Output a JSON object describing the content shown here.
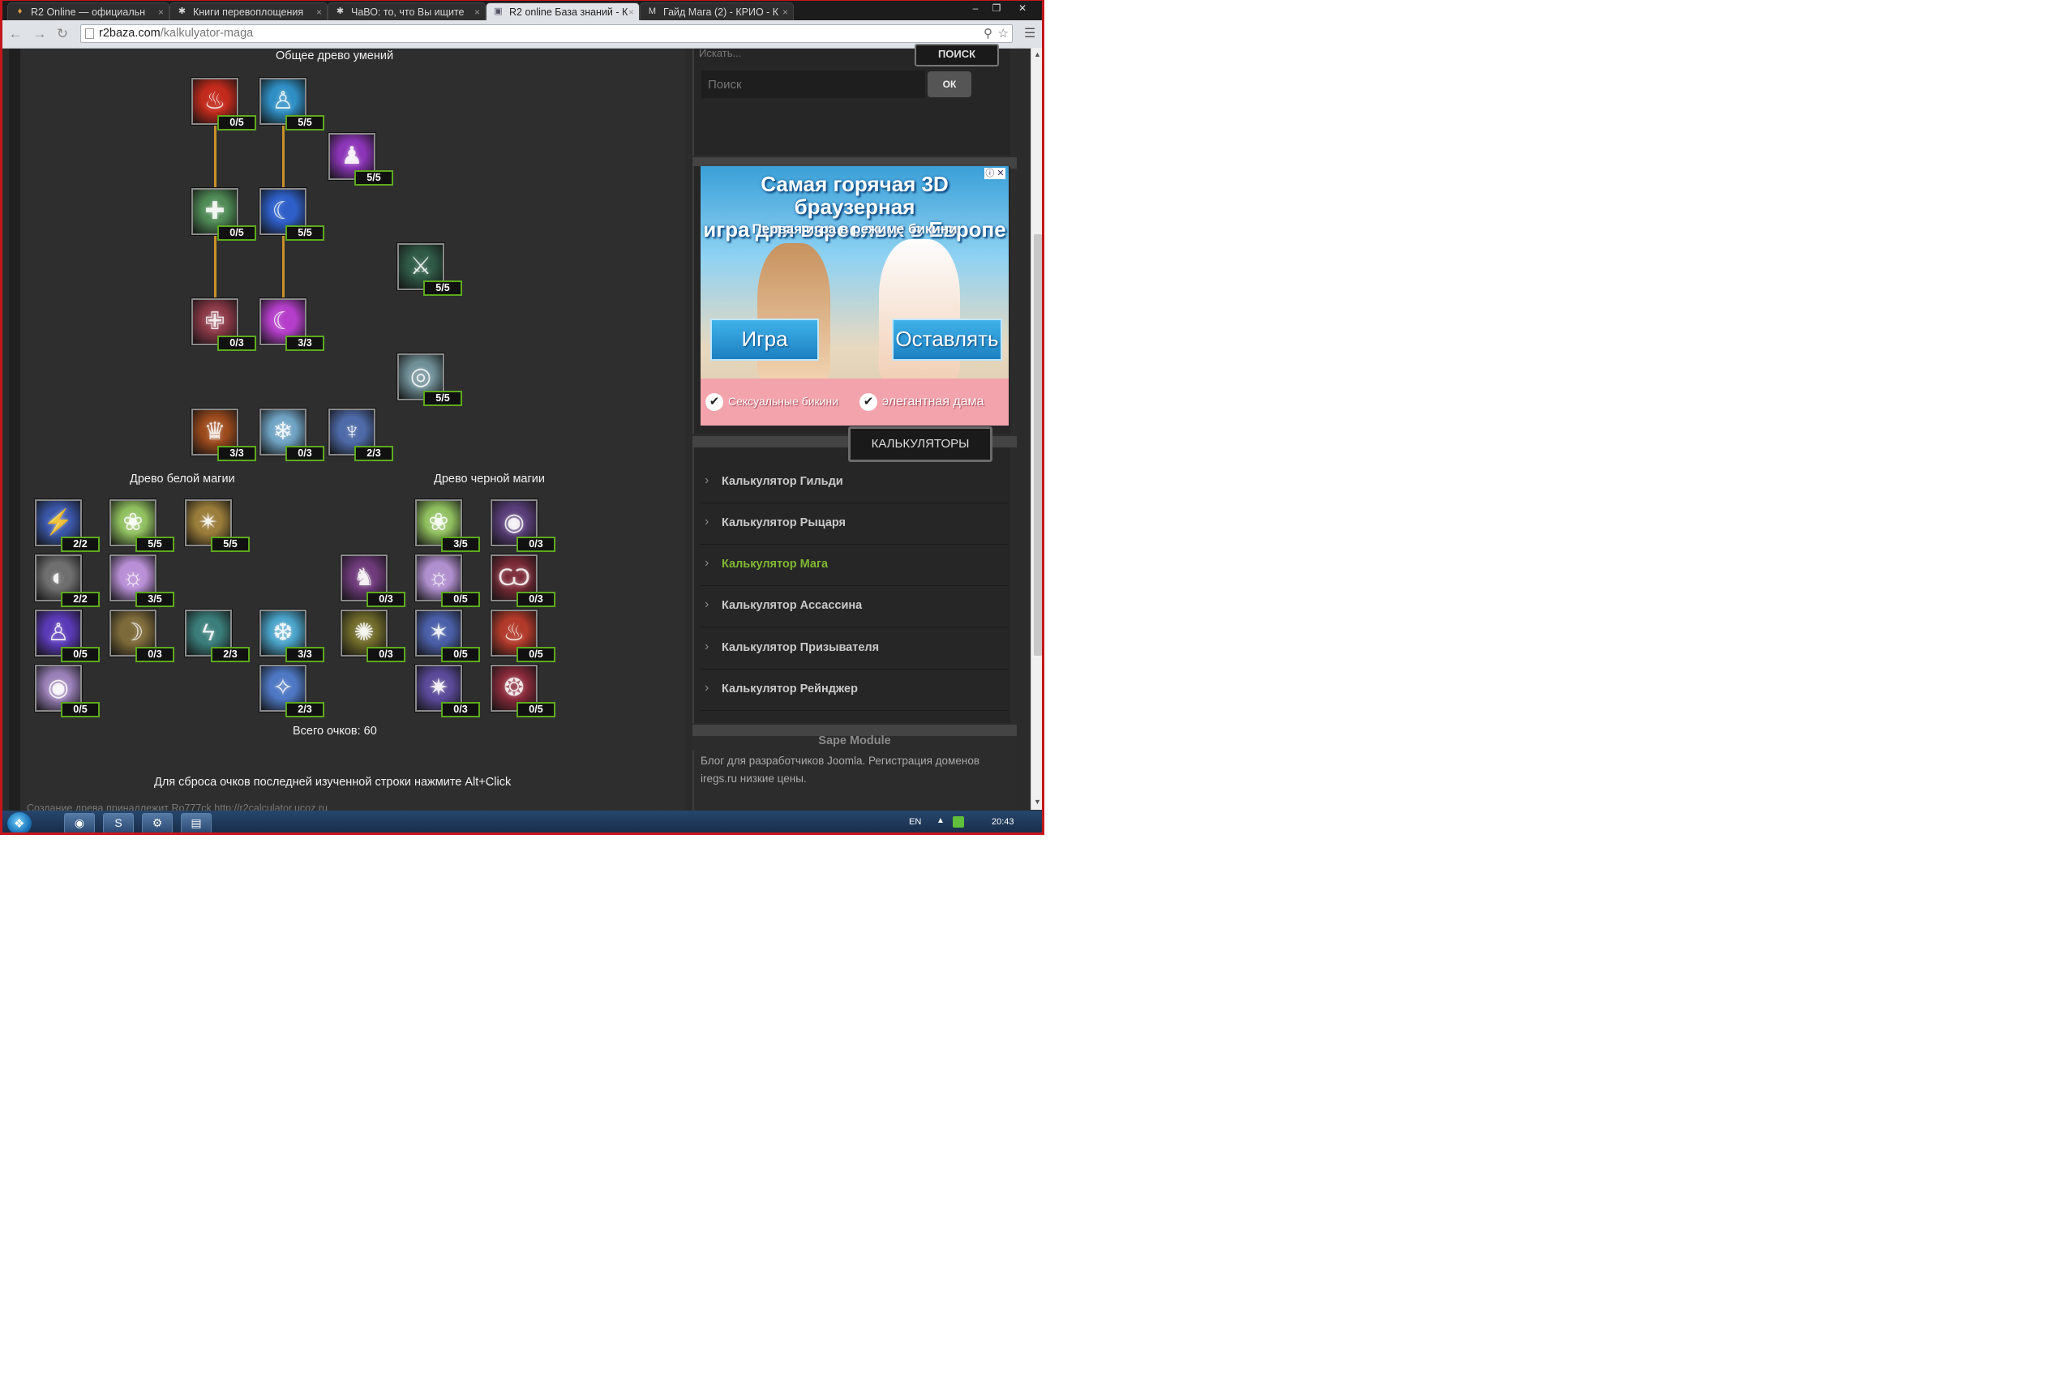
{
  "browser": {
    "tabs": [
      {
        "label": "R2 Online — официальн",
        "active": false
      },
      {
        "label": "Книги перевоплощения",
        "active": false
      },
      {
        "label": "ЧаВО: то, что Вы ищите",
        "active": false
      },
      {
        "label": "R2 online База знаний - К",
        "active": true
      },
      {
        "label": "Гайд Мага (2) - КРИО - К",
        "active": false
      }
    ],
    "url_host": "r2baza.com",
    "url_path": "/kalkulyator-maga"
  },
  "tree": {
    "common_title": "Общее древо умений",
    "white_title": "Древо белой магии",
    "black_title": "Древо черной магии",
    "total_label": "Всего очков: 60",
    "reset_hint": "Для сброса очков последней изученной строки нажмите Alt+Click",
    "status_link": "Создание древа принадлежит Ro777ck http://r2calculator.ucoz.ru"
  },
  "skills": {
    "c1": {
      "lvl": "0/5",
      "color": "#c22a1c"
    },
    "c2": {
      "lvl": "5/5",
      "color": "#2f8fc4"
    },
    "c3": {
      "lvl": "5/5",
      "color": "#8d35b8"
    },
    "c4": {
      "lvl": "0/5",
      "color": "#4f8a55"
    },
    "c5": {
      "lvl": "5/5",
      "color": "#2e5fc8"
    },
    "c6": {
      "lvl": "5/5",
      "color": "#2f5a46"
    },
    "c7": {
      "lvl": "0/3",
      "color": "#8a3846"
    },
    "c8": {
      "lvl": "3/3",
      "color": "#b43ec9"
    },
    "c9": {
      "lvl": "5/5",
      "color": "#6f8f97"
    },
    "c10": {
      "lvl": "3/3",
      "color": "#9c4a1c"
    },
    "c11": {
      "lvl": "0/3",
      "color": "#6fa3c4"
    },
    "c12": {
      "lvl": "2/3",
      "color": "#4e6aa8"
    },
    "w1": {
      "lvl": "2/2",
      "color": "#3a56a8"
    },
    "w2": {
      "lvl": "5/5",
      "color": "#8fbf5e"
    },
    "w3": {
      "lvl": "5/5",
      "color": "#9b7d3a"
    },
    "w4": {
      "lvl": "2/2",
      "color": "#6f6f6f"
    },
    "w5": {
      "lvl": "3/5",
      "color": "#b98fd6"
    },
    "w6": {
      "lvl": "0/5",
      "color": "#5b3ab8"
    },
    "w7": {
      "lvl": "0/3",
      "color": "#7d6a3a"
    },
    "w8": {
      "lvl": "2/3",
      "color": "#3a7d7a"
    },
    "w9": {
      "lvl": "3/3",
      "color": "#4aa3c9"
    },
    "w10": {
      "lvl": "0/5",
      "color": "#9a80b8"
    },
    "w11": {
      "lvl": "2/3",
      "color": "#4e78c4"
    },
    "b1": {
      "lvl": "3/5",
      "color": "#8fbf5e"
    },
    "b2": {
      "lvl": "0/3",
      "color": "#5a3e7a"
    },
    "b3": {
      "lvl": "0/3",
      "color": "#6e3a7a"
    },
    "b4": {
      "lvl": "0/5",
      "color": "#b08fce"
    },
    "b5": {
      "lvl": "0/3",
      "color": "#7a2a36"
    },
    "b6": {
      "lvl": "0/3",
      "color": "#6f6a2a"
    },
    "b7": {
      "lvl": "0/5",
      "color": "#4a5fa8"
    },
    "b8": {
      "lvl": "0/5",
      "color": "#b23a2a"
    },
    "b9": {
      "lvl": "0/3",
      "color": "#5a4a9a"
    },
    "b10": {
      "lvl": "0/5",
      "color": "#8a2a3a"
    }
  },
  "sidebar": {
    "search_top_placeholder": "Искать...",
    "search_top_button": "ПОИСК",
    "search_placeholder": "Поиск",
    "search_ok": "ОК",
    "ad": {
      "title_line1": "Самая горячая 3D браузерная",
      "title_line2": "игра для взрослых в Европе",
      "subtitle": "Первая игра в режиме бикини",
      "left_button": "Игра",
      "right_button": "Оставлять",
      "check_left": "Сексуальные бикини",
      "check_right": "элегантная дама"
    },
    "calc_header": "КАЛЬКУЛЯТОРЫ",
    "calculators": [
      {
        "label": "Калькулятор Гильди",
        "active": false
      },
      {
        "label": "Калькулятор Рыцаря",
        "active": false
      },
      {
        "label": "Калькулятор Мага",
        "active": true
      },
      {
        "label": "Калькулятор Ассассина",
        "active": false
      },
      {
        "label": "Калькулятор Призывателя",
        "active": false
      },
      {
        "label": "Калькулятор Рейнджер",
        "active": false
      }
    ],
    "sape_title": "Sape Module",
    "sape_text": "Блог для разработчиков Joomla. Регистрация доменов iregs.ru низкие цены."
  },
  "taskbar": {
    "lang": "EN",
    "clock": "20:43"
  },
  "colors": {
    "accent_green": "#7fb833",
    "level_border": "#5ea91e",
    "connector": "#c8902b",
    "frame_red": "#c4161c"
  }
}
